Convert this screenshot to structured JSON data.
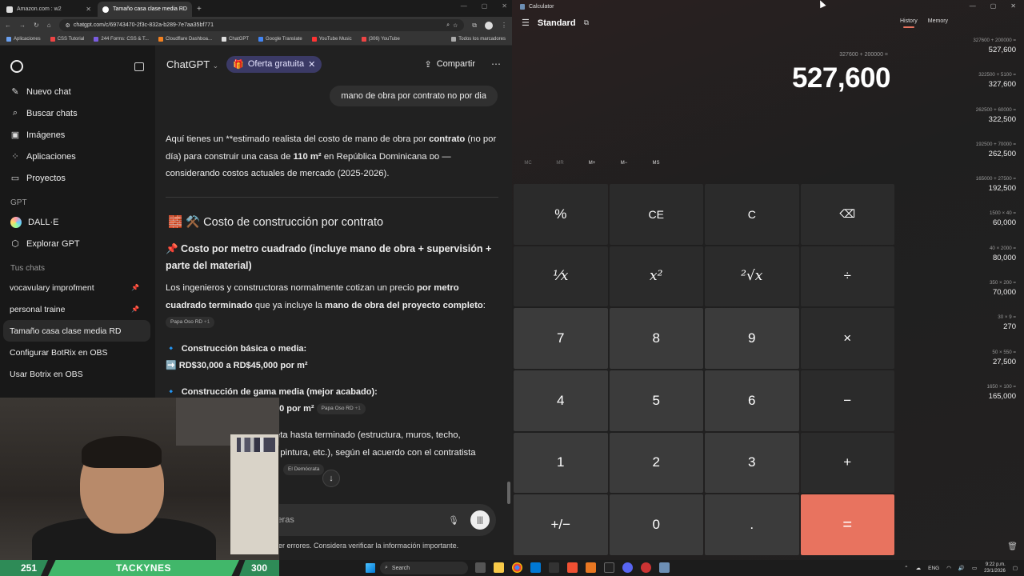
{
  "browser": {
    "tabs": [
      {
        "title": "Amazon.com : w2"
      },
      {
        "title": "Tamaño casa clase media RD"
      }
    ],
    "new_tab": "+",
    "url": "chatgpt.com/c/69743470-2f3c-832a-b289-7e7aa35bf771",
    "bookmarks": [
      "Aplicaciones",
      "CSS Tutorial",
      "244 Forms: CSS & T...",
      "Cloudflare Dashboa...",
      "ChatGPT",
      "Google Translate",
      "YouTube Music",
      "(306) YouTube",
      "Todos los marcadores"
    ]
  },
  "sidebar": {
    "items": [
      {
        "icon": "edit-icon",
        "label": "Nuevo chat"
      },
      {
        "icon": "search-icon",
        "label": "Buscar chats"
      },
      {
        "icon": "image-icon",
        "label": "Imágenes"
      },
      {
        "icon": "apps-icon",
        "label": "Aplicaciones"
      },
      {
        "icon": "folder-icon",
        "label": "Proyectos"
      }
    ],
    "gpt_section": "GPT",
    "gpts": [
      {
        "icon": "dalle-icon",
        "label": "DALL·E"
      },
      {
        "icon": "explore-icon",
        "label": "Explorar GPT"
      }
    ],
    "chats_section": "Tus chats",
    "chats": [
      {
        "label": "vocavulary improfment",
        "pinned": true
      },
      {
        "label": "personal traine",
        "pinned": true
      },
      {
        "label": "Tamaño casa clase media RD",
        "active": true
      },
      {
        "label": "Configurar BotRix en OBS"
      },
      {
        "label": "Usar Botrix en OBS"
      }
    ]
  },
  "chat": {
    "title": "ChatGPT",
    "title_chevron": "⌄",
    "offer_label": "Oferta gratuita",
    "share_label": "Compartir",
    "user_message": "mano de obra por contrato no por dia",
    "intro_1": "Aquí tienes un **estimado realista del costo de mano de obra por ",
    "intro_bold_1": "contrato",
    "intro_2": " (no por día) para construir una casa de ",
    "intro_bold_2": "110 m²",
    "intro_3": " en República Dominicana ᴅᴏ — considerando costos actuales de mercado (2025-2026).",
    "heading": "🧱 ⚒️ Costo de construcción por contrato",
    "subheading": "📌 Costo por metro cuadrado (incluye mano de obra + supervisión + parte del material)",
    "para_1": "Los ingenieros y constructoras normalmente cotizan un precio ",
    "para_bold_1": "por metro cuadrado terminado",
    "para_2": " que ya incluye la ",
    "para_bold_2": "mano de obra del proyecto completo",
    "para_3": ":",
    "cite_1": "Papa Oso RD",
    "cite_1_count": "+1",
    "b1_title": "Construcción básica o media:",
    "b1_value": "RD$30,000 a RD$45,000 por m²",
    "b2_title": "Construcción de gama media (mejor acabado):",
    "b2_value": "00 por m²",
    "cite_2": "Papa Oso RD",
    "cite_2_count": "+1",
    "b3_text_1": "eta hasta terminado (estructura, muros, techo,",
    "b3_text_2": ", pintura, etc.), según el acuerdo con el contratista",
    "cite_3": "El Demócrata",
    "composer_placeholder": "ieras",
    "disclaimer": "er errores. Considera verificar la información importante."
  },
  "stream": {
    "left_count": "251",
    "name": "TACKYNES",
    "right_count": "300"
  },
  "calculator": {
    "app_title": "Calculator",
    "mode": "Standard",
    "expression": "327600 + 200000 =",
    "display": "527,600",
    "memory_buttons": [
      "MC",
      "MR",
      "M+",
      "M−",
      "MS"
    ],
    "keys": [
      "%",
      "CE",
      "C",
      "⌫",
      "¹⁄x",
      "x²",
      "²√x",
      "÷",
      "7",
      "8",
      "9",
      "×",
      "4",
      "5",
      "6",
      "−",
      "1",
      "2",
      "3",
      "+",
      "+/−",
      "0",
      ".",
      "="
    ],
    "history_tab": "History",
    "memory_tab": "Memory",
    "history": [
      {
        "expr": "327600 + 200000 =",
        "result": "527,600"
      },
      {
        "expr": "322500 + 5100 =",
        "result": "327,600"
      },
      {
        "expr": "262500 + 60000 =",
        "result": "322,500"
      },
      {
        "expr": "192500 + 70000 =",
        "result": "262,500"
      },
      {
        "expr": "165000 + 27500 =",
        "result": "192,500"
      },
      {
        "expr": "1500 × 40 =",
        "result": "60,000"
      },
      {
        "expr": "40 × 2000 =",
        "result": "80,000"
      },
      {
        "expr": "350 × 200 =",
        "result": "70,000"
      },
      {
        "expr": "30 × 9 =",
        "result": "270"
      },
      {
        "expr": "50 × 550 =",
        "result": "27,500"
      },
      {
        "expr": "1650 × 100 =",
        "result": "165,000"
      }
    ]
  },
  "taskbar": {
    "search_placeholder": "Search",
    "lang": "ENG",
    "time": "9:22 p.m.",
    "date": "23/1/2026"
  }
}
